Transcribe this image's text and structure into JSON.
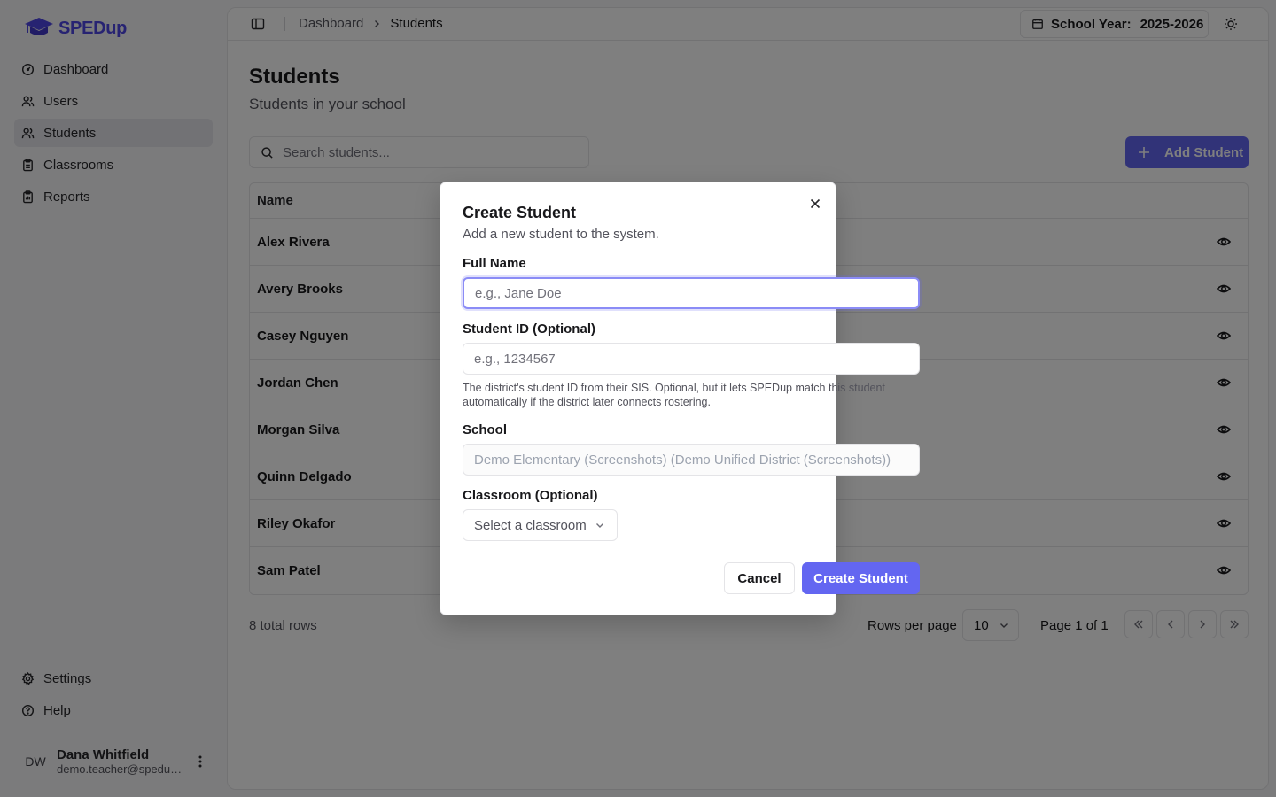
{
  "app": {
    "name": "SPEDup",
    "brand_color": "#4f46e5",
    "accent_color": "#6366f1"
  },
  "sidebar": {
    "items": [
      {
        "label": "Dashboard",
        "icon": "gauge-icon",
        "active": false
      },
      {
        "label": "Users",
        "icon": "users-icon",
        "active": false
      },
      {
        "label": "Students",
        "icon": "users-icon",
        "active": true
      },
      {
        "label": "Classrooms",
        "icon": "clipboard-icon",
        "active": false
      },
      {
        "label": "Reports",
        "icon": "report-icon",
        "active": false
      }
    ],
    "bottom_items": [
      {
        "label": "Settings",
        "icon": "gear-icon"
      },
      {
        "label": "Help",
        "icon": "help-circle-icon"
      }
    ],
    "user": {
      "initials": "DW",
      "name": "Dana Whitfield",
      "email": "demo.teacher@spedup..."
    }
  },
  "header": {
    "breadcrumb": [
      "Dashboard",
      "Students"
    ],
    "school_year_label": "School Year:",
    "school_year_value": "2025-2026"
  },
  "page": {
    "title": "Students",
    "subtitle": "Students in your school",
    "search_placeholder": "Search students...",
    "add_button": "Add Student"
  },
  "table": {
    "columns": [
      "Name"
    ],
    "rows": [
      "Alex Rivera",
      "Avery Brooks",
      "Casey Nguyen",
      "Jordan Chen",
      "Morgan Silva",
      "Quinn Delgado",
      "Riley Okafor",
      "Sam Patel"
    ]
  },
  "pagination": {
    "total_rows": "8 total rows",
    "rows_per_page_label": "Rows per page",
    "rows_per_page_value": "10",
    "page_info": "Page 1 of 1"
  },
  "dialog": {
    "title": "Create Student",
    "description": "Add a new student to the system.",
    "full_name_label": "Full Name",
    "full_name_placeholder": "e.g., Jane Doe",
    "student_id_label": "Student ID (Optional)",
    "student_id_placeholder": "e.g., 1234567",
    "student_id_hint": "The district's student ID from their SIS. Optional, but it lets SPEDup match this student automatically if the district later connects rostering.",
    "school_label": "School",
    "school_value": "Demo Elementary (Screenshots) (Demo Unified District (Screenshots))",
    "classroom_label": "Classroom (Optional)",
    "classroom_placeholder": "Select a classroom",
    "cancel_label": "Cancel",
    "submit_label": "Create Student"
  }
}
